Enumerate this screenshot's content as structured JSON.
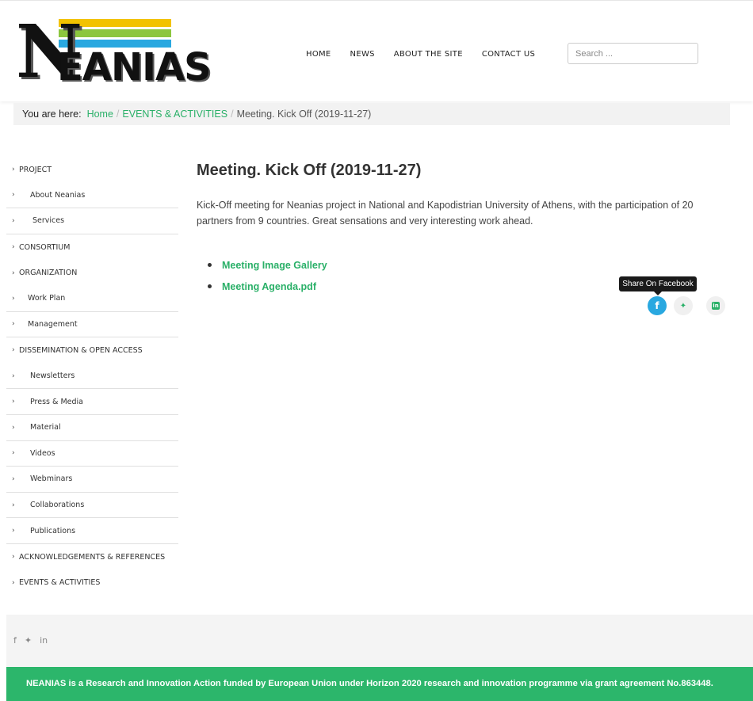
{
  "logo": {
    "first_letter": "N",
    "rest": "EANIAS"
  },
  "nav": {
    "home": "HOME",
    "news": "NEWS",
    "about": "ABOUT THE SITE",
    "contact": "CONTACT US"
  },
  "search": {
    "placeholder": "Search ..."
  },
  "breadcrumb": {
    "label": "You are here:",
    "home": "Home",
    "section": "EVENTS & ACTIVITIES",
    "current": "Meeting. Kick Off (2019-11-27)"
  },
  "sidebar": {
    "items": [
      {
        "label": "PROJECT",
        "level": "top"
      },
      {
        "label": "About Neanias",
        "level": "sub"
      },
      {
        "label": "Services",
        "level": "sub2"
      },
      {
        "label": "CONSORTIUM",
        "level": "top"
      },
      {
        "label": "ORGANIZATION",
        "level": "top"
      },
      {
        "label": "Work Plan",
        "level": "sub"
      },
      {
        "label": "Management",
        "level": "sub"
      },
      {
        "label": "DISSEMINATION & OPEN ACCESS",
        "level": "top"
      },
      {
        "label": "Newsletters",
        "level": "sub"
      },
      {
        "label": "Press & Media",
        "level": "sub"
      },
      {
        "label": "Material",
        "level": "sub"
      },
      {
        "label": "Videos",
        "level": "sub"
      },
      {
        "label": "Webminars",
        "level": "sub"
      },
      {
        "label": "Collaborations",
        "level": "sub"
      },
      {
        "label": "Publications",
        "level": "sub"
      },
      {
        "label": "ACKNOWLEDGEMENTS & REFERENCES",
        "level": "top"
      },
      {
        "label": "EVENTS & ACTIVITIES",
        "level": "top"
      }
    ]
  },
  "main": {
    "title": "Meeting. Kick Off (2019-11-27)",
    "description": "Kick-Off meeting for Neanias project in National and Kapodistrian University of Athens, with the participation of 20 partners from 9 countries. Great sensations and very interesting work ahead.",
    "links": [
      {
        "label": "Meeting Image Gallery"
      },
      {
        "label": "Meeting Agenda.pdf"
      }
    ]
  },
  "share": {
    "tooltip": "Share On Facebook",
    "facebook_glyph": "f",
    "twitter_glyph": "🐦",
    "linkedin_glyph": "in"
  },
  "footer": {
    "social_facebook": "f",
    "social_twitter": "🐦",
    "social_linkedin": "in",
    "funding_text": "NEANIAS is a Research and Innovation Action funded by European Union under Horizon 2020 research and innovation programme via grant agreement No.863448.",
    "accent_color": "#2cb66b"
  }
}
